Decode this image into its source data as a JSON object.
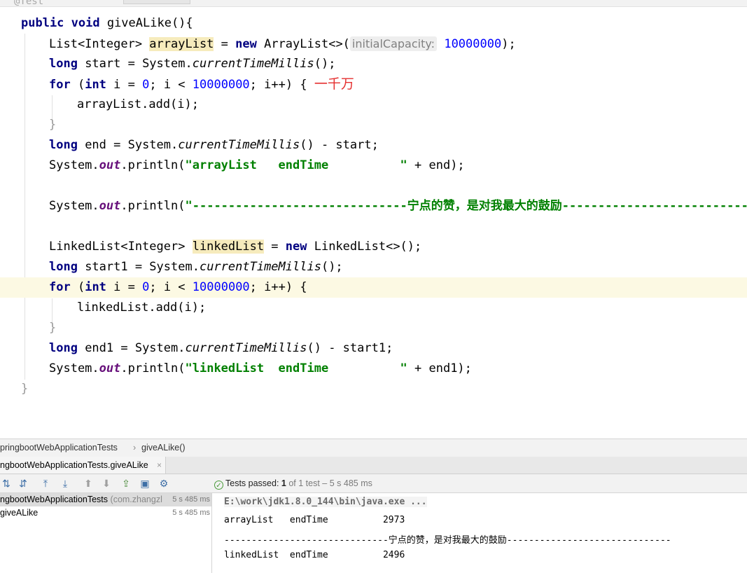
{
  "editor": {
    "top_fragment": "@Test",
    "lines": {
      "l1_kw": "public void",
      "l1_rest": " giveALike(){",
      "l2_a": "List<Integer> ",
      "l2_var": "arrayList",
      "l2_b": " = ",
      "l2_new": "new",
      "l2_c": " ArrayList<>(",
      "l2_hint": "initialCapacity:",
      "l2_num": "10000000",
      "l2_d": ");",
      "l3_kw": "long",
      "l3_a": " start = System.",
      "l3_it": "currentTimeMillis",
      "l3_b": "();",
      "l4_for": "for",
      "l4_a": " (",
      "l4_int": "int",
      "l4_b": " i = ",
      "l4_zero": "0",
      "l4_c": "; i < ",
      "l4_num": "10000000",
      "l4_d": "; i++) {",
      "l4_anno": "一千万",
      "l5": "arrayList.add(i);",
      "l6": "}",
      "l7_kw": "long",
      "l7_a": " end = System.",
      "l7_it": "currentTimeMillis",
      "l7_b": "() - start;",
      "l8_a": "System.",
      "l8_out": "out",
      "l8_b": ".println(",
      "l8_str": "\"arrayList   endTime          \"",
      "l8_c": " + end);",
      "l10_a": "System.",
      "l10_out": "out",
      "l10_b": ".println(",
      "l10_str": "\"------------------------------宁点的赞，是对我最大的鼓励------------------------------\");",
      "l12_a": "LinkedList<Integer> ",
      "l12_var": "linkedList",
      "l12_b": " = ",
      "l12_new": "new",
      "l12_c": " LinkedList<>();",
      "l13_kw": "long",
      "l13_a": " start1 = System.",
      "l13_it": "currentTimeMillis",
      "l13_b": "();",
      "l14_for": "for",
      "l14_a": " (",
      "l14_int": "int",
      "l14_b": " i = ",
      "l14_zero": "0",
      "l14_c": "; i < ",
      "l14_num": "10000000",
      "l14_d": "; i++) {",
      "l15": "linkedList.add(i);",
      "l16": "}",
      "l17_kw": "long",
      "l17_a": " end1 = System.",
      "l17_it": "currentTimeMillis",
      "l17_b": "() - start1;",
      "l18_a": "System.",
      "l18_out": "out",
      "l18_b": ".println(",
      "l18_str": "\"linkedList  endTime          \"",
      "l18_c": " + end1);",
      "l19": "}"
    }
  },
  "breadcrumb": {
    "class_name": "pringbootWebApplicationTests",
    "separator": "›",
    "method": "giveALike()"
  },
  "run_tab": {
    "label": "ngbootWebApplicationTests.giveALike",
    "close": "×"
  },
  "toolbar": {
    "icons": [
      "sort-alpha-icon",
      "sort-duration-icon",
      "expand-all-icon",
      "collapse-all-icon",
      "previous-failed-icon",
      "next-failed-icon",
      "export-icon",
      "import-icon",
      "settings-icon"
    ],
    "status_label": "Tests passed:",
    "passed_count": "1",
    "status_rest": "of 1 test – 5 s 485 ms"
  },
  "test_tree": [
    {
      "name": "ngbootWebApplicationTests",
      "pkg": "(com.zhangzl",
      "duration": "5 s 485 ms"
    },
    {
      "name": "giveALike",
      "pkg": "",
      "duration": "5 s 485 ms"
    }
  ],
  "console": {
    "cmd": "E:\\work\\jdk1.8.0_144\\bin\\java.exe ...",
    "line1": "arrayList   endTime          2973",
    "line2": "------------------------------宁点的赞，是对我最大的鼓励------------------------------",
    "line3": "linkedList  endTime          2496"
  },
  "colors": {
    "keyword": "#000080",
    "number": "#0000ff",
    "string": "#008000",
    "static_field": "#660e7a",
    "annotation_red": "#e53030",
    "current_line": "#fcf9e3",
    "highlight": "#f6ebbc"
  }
}
